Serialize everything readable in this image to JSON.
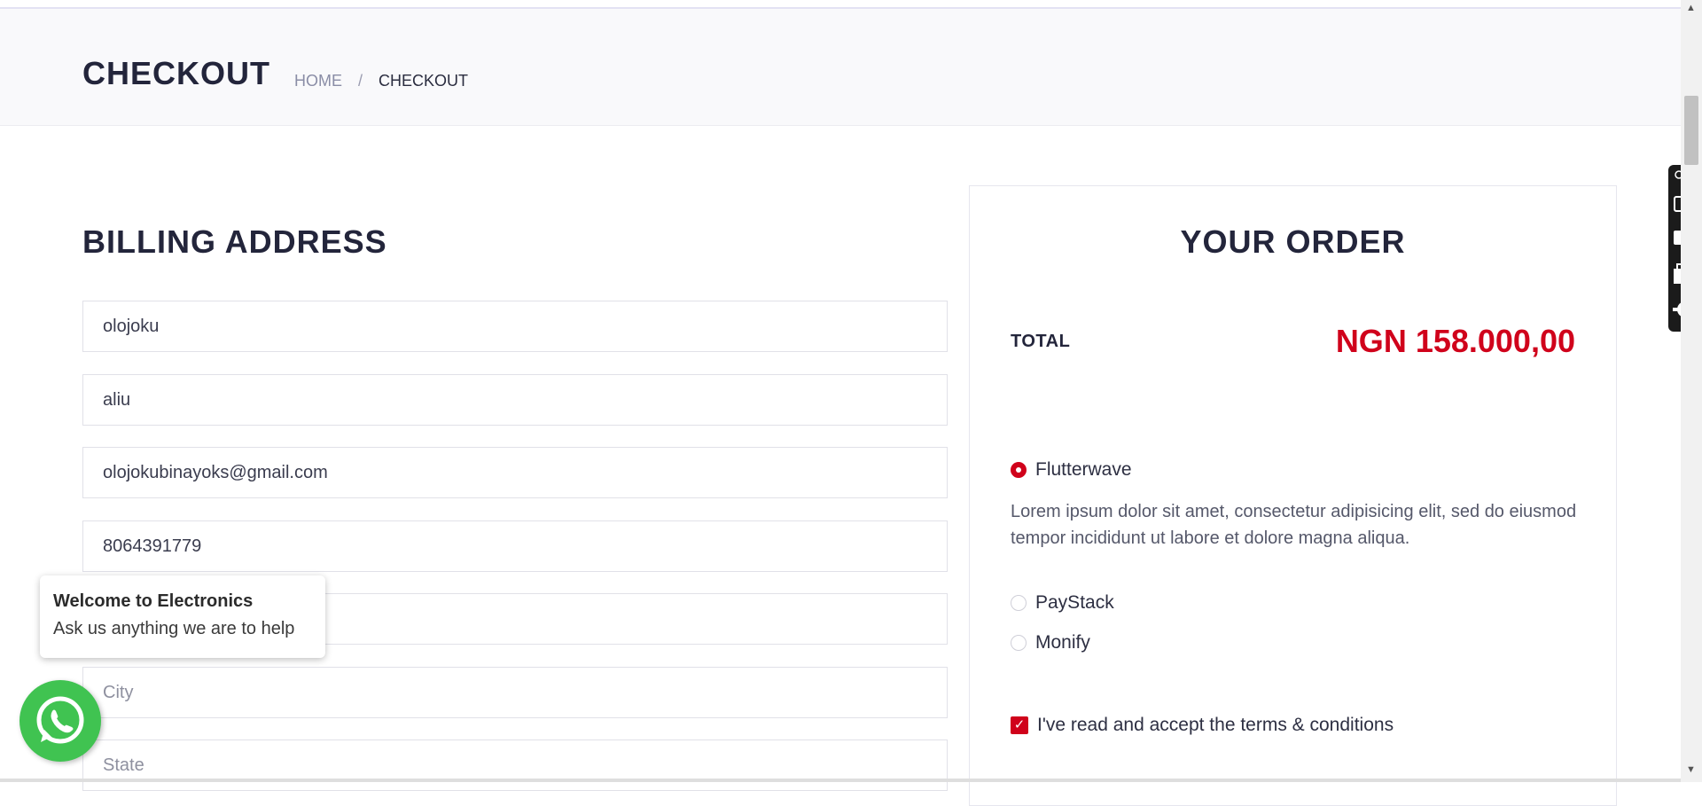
{
  "header": {
    "title": "CHECKOUT",
    "breadcrumb": {
      "home": "HOME",
      "separator": "/",
      "current": "CHECKOUT"
    }
  },
  "billing": {
    "title": "BILLING ADDRESS",
    "fields": [
      {
        "value": "olojoku",
        "placeholder": ""
      },
      {
        "value": "aliu",
        "placeholder": ""
      },
      {
        "value": "olojokubinayoks@gmail.com",
        "placeholder": ""
      },
      {
        "value": "8064391779",
        "placeholder": ""
      },
      {
        "value": "",
        "placeholder": ""
      },
      {
        "value": "",
        "placeholder": "City"
      },
      {
        "value": "",
        "placeholder": "State"
      }
    ]
  },
  "order": {
    "title": "YOUR ORDER",
    "total_label": "TOTAL",
    "total_amount": "NGN 158.000,00",
    "payment_options": [
      {
        "label": "Flutterwave",
        "selected": true
      },
      {
        "label": "PayStack",
        "selected": false
      },
      {
        "label": "Monify",
        "selected": false
      }
    ],
    "payment_description": "Lorem ipsum dolor sit amet, consectetur adipisicing elit, sed do eiusmod tempor incididunt ut labore et dolore magna aliqua.",
    "terms_label": "I've read and accept the terms & conditions",
    "terms_checked": true
  },
  "chat": {
    "title": "Welcome to Electronics",
    "subtitle": "Ask us anything we are to help"
  },
  "toolbar": {
    "icons": [
      "link-icon",
      "more-icon",
      "camera-icon",
      "video-icon",
      "window-icon",
      "gear-icon"
    ]
  },
  "colors": {
    "accent": "#d0021b",
    "heading": "#23253b",
    "whatsapp": "#40c351"
  }
}
